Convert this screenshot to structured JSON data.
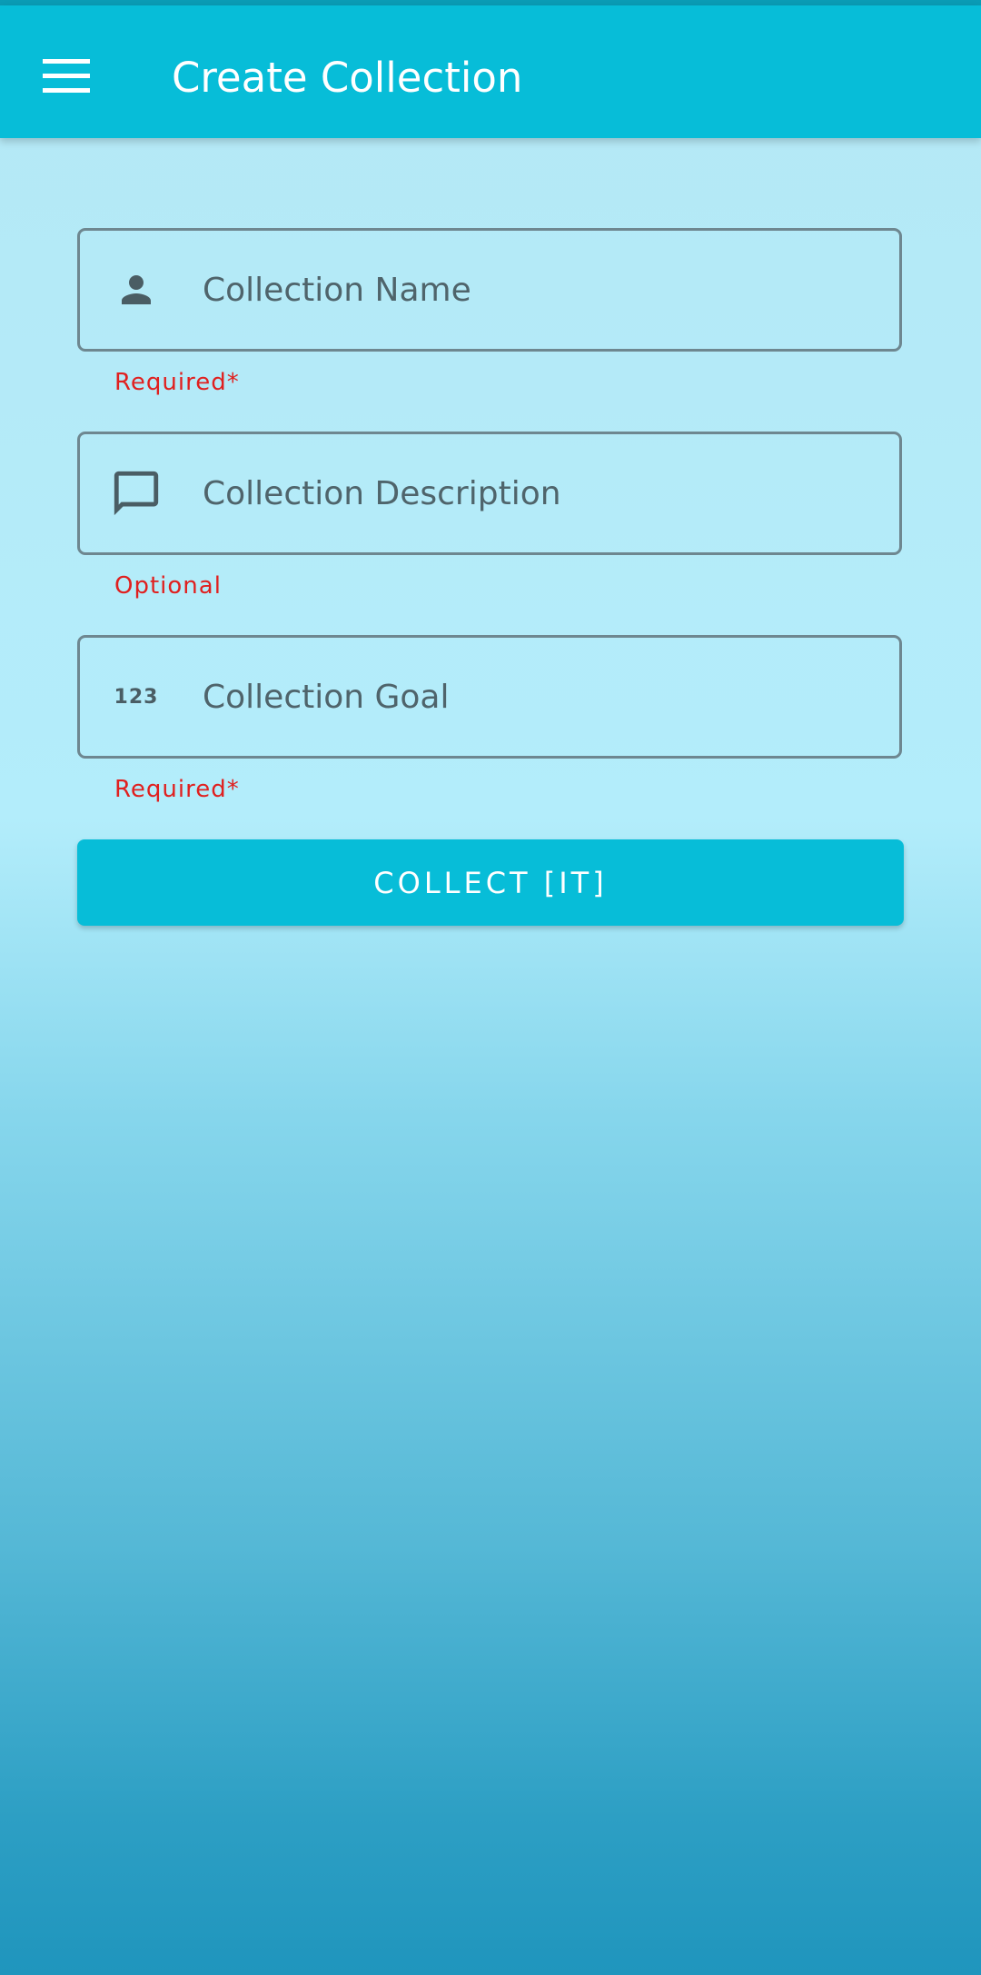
{
  "app_bar": {
    "title": "Create Collection",
    "menu_icon": "menu-icon"
  },
  "form": {
    "fields": [
      {
        "placeholder": "Collection Name",
        "value": "",
        "icon": "person-icon",
        "helper": "Required*"
      },
      {
        "placeholder": "Collection Description",
        "value": "",
        "icon": "comment-icon",
        "helper": "Optional"
      },
      {
        "placeholder": "Collection Goal",
        "value": "",
        "icon": "numbers-icon",
        "icon_text": "123",
        "helper": "Required*"
      }
    ],
    "submit_label": "COLLECT [IT]"
  },
  "colors": {
    "accent": "#07bdd8",
    "helper_text": "#e0201f",
    "field_border": "#6e8790"
  }
}
